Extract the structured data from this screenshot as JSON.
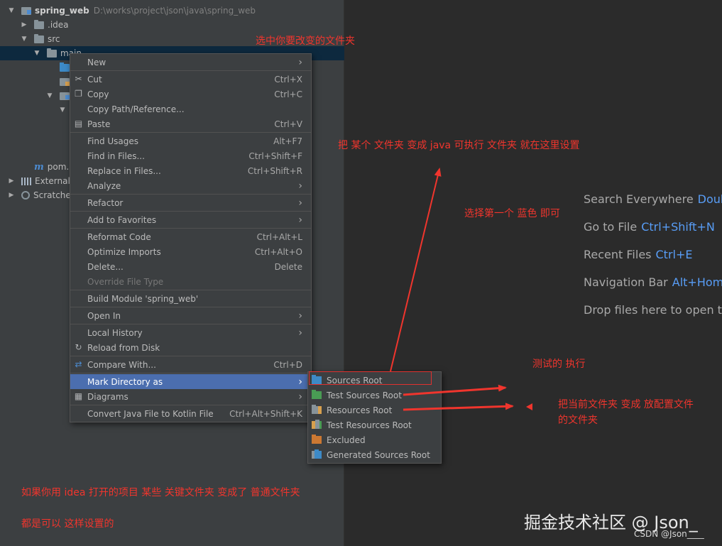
{
  "project_tree": {
    "root": {
      "name": "spring_web",
      "path": "D:\\works\\project\\json\\java\\spring_web"
    },
    "idea": ".idea",
    "src": "src",
    "main": "main",
    "pom": "pom.",
    "external": "External",
    "scratches": "Scratche"
  },
  "context_menu": {
    "items": [
      {
        "label": "New",
        "shortcut": "",
        "submenu": true
      },
      {
        "label": "Cut",
        "shortcut": "Ctrl+X",
        "icon": "scissors-icon"
      },
      {
        "label": "Copy",
        "shortcut": "Ctrl+C",
        "icon": "copy-icon"
      },
      {
        "label": "Copy Path/Reference...",
        "shortcut": ""
      },
      {
        "label": "Paste",
        "shortcut": "Ctrl+V",
        "icon": "paste-icon"
      },
      {
        "label": "Find Usages",
        "shortcut": "Alt+F7"
      },
      {
        "label": "Find in Files...",
        "shortcut": "Ctrl+Shift+F"
      },
      {
        "label": "Replace in Files...",
        "shortcut": "Ctrl+Shift+R"
      },
      {
        "label": "Analyze",
        "shortcut": "",
        "submenu": true
      },
      {
        "label": "Refactor",
        "shortcut": "",
        "submenu": true
      },
      {
        "label": "Add to Favorites",
        "shortcut": "",
        "submenu": true
      },
      {
        "label": "Reformat Code",
        "shortcut": "Ctrl+Alt+L"
      },
      {
        "label": "Optimize Imports",
        "shortcut": "Ctrl+Alt+O"
      },
      {
        "label": "Delete...",
        "shortcut": "Delete"
      },
      {
        "label": "Override File Type",
        "shortcut": "",
        "disabled": true
      },
      {
        "label": "Build Module 'spring_web'",
        "shortcut": ""
      },
      {
        "label": "Open In",
        "shortcut": "",
        "submenu": true
      },
      {
        "label": "Local History",
        "shortcut": "",
        "submenu": true
      },
      {
        "label": "Reload from Disk",
        "shortcut": "",
        "icon": "reload-icon"
      },
      {
        "label": "Compare With...",
        "shortcut": "Ctrl+D",
        "icon": "compare-icon"
      },
      {
        "label": "Mark Directory as",
        "shortcut": "",
        "submenu": true,
        "active": true
      },
      {
        "label": "Diagrams",
        "shortcut": "",
        "submenu": true,
        "icon": "diagram-icon"
      },
      {
        "label": "Convert Java File to Kotlin File",
        "shortcut": "Ctrl+Alt+Shift+K"
      }
    ]
  },
  "mark_directory_submenu": [
    {
      "label": "Sources Root",
      "color": "#3d8ac7"
    },
    {
      "label": "Test Sources Root",
      "color": "#499c54"
    },
    {
      "label": "Resources Root",
      "color": "#87939a"
    },
    {
      "label": "Test Resources Root",
      "color": "#87939a"
    },
    {
      "label": "Excluded",
      "color": "#cc7832"
    },
    {
      "label": "Generated Sources Root",
      "color": "#3d8ac7"
    }
  ],
  "welcome": {
    "search": {
      "label": "Search Everywhere",
      "key": "Doub"
    },
    "goto": {
      "label": "Go to File",
      "key": "Ctrl+Shift+N"
    },
    "recent": {
      "label": "Recent Files",
      "key": "Ctrl+E"
    },
    "nav": {
      "label": "Navigation Bar",
      "key": "Alt+Home"
    },
    "drop": {
      "label": "Drop files here to open th"
    }
  },
  "annotations": {
    "select_folder": "选中你要改变的文件夹",
    "make_java": "把 某个 文件夹 变成 java 可执行 文件夹 就在这里设置",
    "choose_first": "选择第一个 蓝色 即可",
    "test_exec": "测试的 执行",
    "config_folder_line1": "把当前文件夹 变成 放配置文件",
    "config_folder_line2": "的文件夹",
    "bottom_line1": "如果你用 idea 打开的项目 某些 关键文件夹 变成了 普通文件夹",
    "bottom_line2": "都是可以 这样设置的"
  },
  "watermark": "掘金技术社区 @ Json_",
  "csdn": "CSDN @Json____"
}
